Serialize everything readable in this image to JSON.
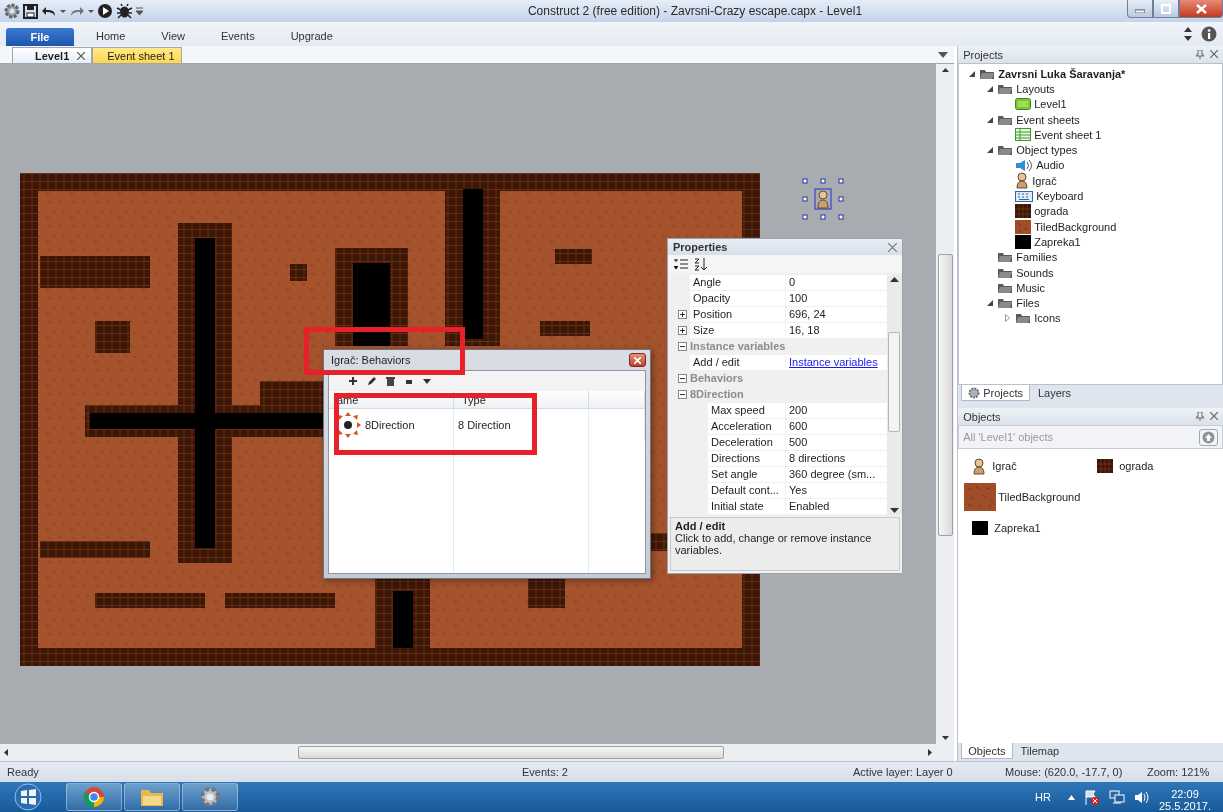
{
  "window": {
    "title": "Construct 2  (free edition) - Zavrsni-Crazy escape.capx - Level1"
  },
  "ribbon": {
    "file_button": "File",
    "tabs": [
      "Home",
      "View",
      "Events",
      "Upgrade"
    ]
  },
  "document_tabs": [
    {
      "label": "Level1",
      "kind": "layout",
      "selected": true,
      "closable": true
    },
    {
      "label": "Event sheet 1",
      "kind": "event_sheet",
      "selected": false,
      "closable": false
    }
  ],
  "properties": {
    "title": "Properties",
    "rows": [
      {
        "label": "Angle",
        "value": "0"
      },
      {
        "label": "Opacity",
        "value": "100"
      },
      {
        "label": "Position",
        "value": "696, 24",
        "expanded": false
      },
      {
        "label": "Size",
        "value": "16, 18",
        "expanded": false
      },
      {
        "label": "Instance variables",
        "kind": "section",
        "expanded": true,
        "children": [
          {
            "label": "Add / edit",
            "link": "Instance variables"
          }
        ]
      },
      {
        "label": "Behaviors",
        "kind": "section",
        "expanded": true,
        "children": [
          {
            "label": "8Direction",
            "kind": "section",
            "expanded": true,
            "children": [
              {
                "label": "Max speed",
                "value": "200"
              },
              {
                "label": "Acceleration",
                "value": "600"
              },
              {
                "label": "Deceleration",
                "value": "500"
              },
              {
                "label": "Directions",
                "value": "8 directions"
              },
              {
                "label": "Set angle",
                "value": "360 degree (sm..."
              },
              {
                "label": "Default cont...",
                "value": "Yes"
              },
              {
                "label": "Initial state",
                "value": "Enabled"
              }
            ]
          }
        ]
      }
    ],
    "description": {
      "title": "Add / edit",
      "text": "Click to add, change or remove instance variables."
    }
  },
  "behaviors_dialog": {
    "title": "Igrač: Behaviors",
    "columns": [
      "ame",
      "Type"
    ],
    "rows": [
      {
        "name": "8Direction",
        "type": "8 Direction"
      }
    ]
  },
  "projects": {
    "title": "Projects",
    "tree": [
      {
        "label": "Zavrsni Luka Šaravanja*",
        "kind": "project",
        "expanded": true,
        "children": [
          {
            "label": "Layouts",
            "kind": "folder",
            "expanded": true,
            "children": [
              {
                "label": "Level1",
                "kind": "layout"
              }
            ]
          },
          {
            "label": "Event sheets",
            "kind": "folder",
            "expanded": true,
            "children": [
              {
                "label": "Event sheet 1",
                "kind": "event_sheet"
              }
            ]
          },
          {
            "label": "Object types",
            "kind": "folder",
            "expanded": true,
            "children": [
              {
                "label": "Audio",
                "kind": "audio"
              },
              {
                "label": "Igrač",
                "kind": "sprite"
              },
              {
                "label": "Keyboard",
                "kind": "keyboard"
              },
              {
                "label": "ograda",
                "kind": "tiles"
              },
              {
                "label": "TiledBackground",
                "kind": "texture"
              },
              {
                "label": "Zapreka1",
                "kind": "solid"
              }
            ]
          },
          {
            "label": "Families",
            "kind": "folder"
          },
          {
            "label": "Sounds",
            "kind": "folder"
          },
          {
            "label": "Music",
            "kind": "folder"
          },
          {
            "label": "Files",
            "kind": "folder",
            "expanded": true,
            "children": [
              {
                "label": "Icons",
                "kind": "folder",
                "expanded": false
              }
            ]
          }
        ]
      }
    ],
    "tabs": [
      {
        "label": "Projects",
        "selected": true
      },
      {
        "label": "Layers",
        "selected": false
      }
    ]
  },
  "objects": {
    "title": "Objects",
    "filter": "All 'Level1' objects",
    "items": [
      {
        "label": "Igrač",
        "kind": "sprite"
      },
      {
        "label": "ograda",
        "kind": "tiles"
      },
      {
        "label": "TiledBackground",
        "kind": "texture"
      },
      {
        "label": "Zapreka1",
        "kind": "solid"
      }
    ],
    "tabs": [
      {
        "label": "Objects",
        "selected": true
      },
      {
        "label": "Tilemap",
        "selected": false
      }
    ]
  },
  "status_bar": [
    "Ready",
    "Events: 2",
    "Active layer: Layer 0",
    "Mouse: (620.0, -17.7, 0)",
    "Zoom: 121%"
  ],
  "taskbar": {
    "language": "HR",
    "time": "22:09",
    "date": "25.5.2017."
  }
}
